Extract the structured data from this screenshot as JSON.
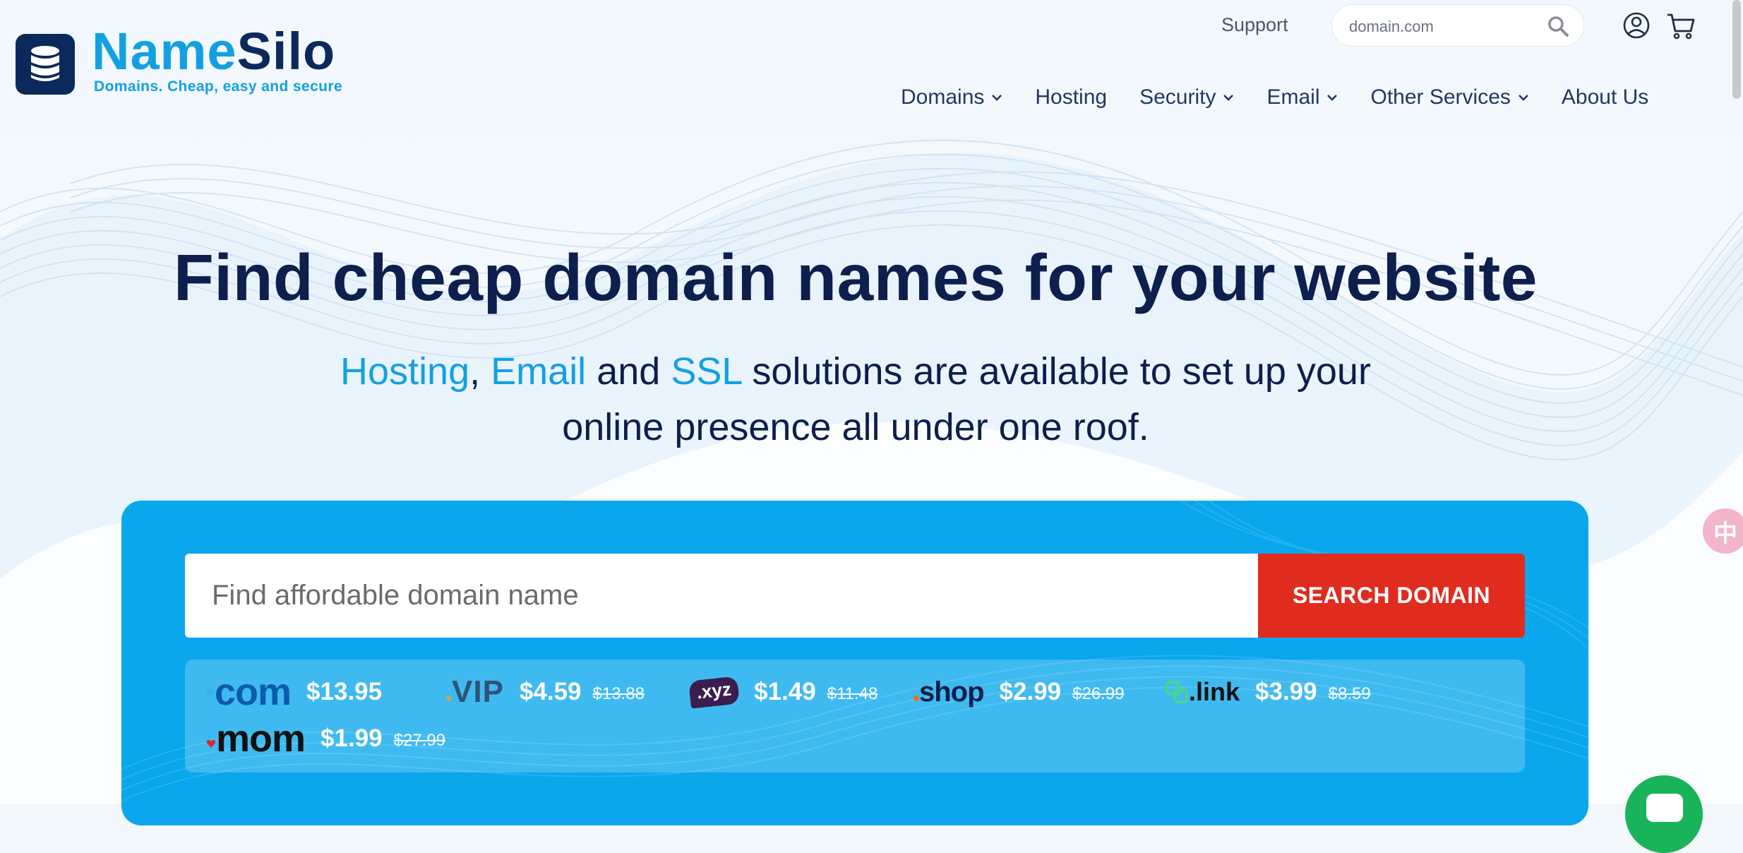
{
  "brand": {
    "name_part1": "Name",
    "name_part2": "Silo",
    "tagline": "Domains. Cheap, easy and secure",
    "logo_icon": "database-icon"
  },
  "topbar": {
    "support_label": "Support",
    "search_placeholder": "domain.com",
    "search_icon": "search-icon",
    "user_icon": "user-circle-icon",
    "cart_icon": "cart-icon"
  },
  "nav": {
    "items": [
      {
        "label": "Domains",
        "has_dropdown": true
      },
      {
        "label": "Hosting",
        "has_dropdown": false
      },
      {
        "label": "Security",
        "has_dropdown": true
      },
      {
        "label": "Email",
        "has_dropdown": true
      },
      {
        "label": "Other Services",
        "has_dropdown": true
      },
      {
        "label": "About Us",
        "has_dropdown": false
      }
    ]
  },
  "hero": {
    "title": "Find cheap domain names for your website",
    "sub_hosting": "Hosting",
    "sub_comma": ",",
    "sub_email": "Email",
    "sub_and": "and",
    "sub_ssl": "SSL",
    "sub_rest1": "solutions are available to set up your",
    "sub_rest2": "online presence all under one roof."
  },
  "search": {
    "placeholder": "Find affordable domain name",
    "button_label": "SEARCH DOMAIN"
  },
  "tlds": [
    {
      "name": ".com",
      "logo_text": "com",
      "price": "$13.95",
      "old_price": ""
    },
    {
      "name": ".VIP",
      "logo_text": "VIP",
      "price": "$4.59",
      "old_price": "$13.88"
    },
    {
      "name": ".xyz",
      "logo_text": ".xyz",
      "price": "$1.49",
      "old_price": "$11.48"
    },
    {
      "name": ".shop",
      "logo_text": "shop",
      "price": "$2.99",
      "old_price": "$26.99"
    },
    {
      "name": ".link",
      "logo_text": ".link",
      "price": "$3.99",
      "old_price": "$8.59"
    },
    {
      "name": ".mom",
      "logo_text": "mom",
      "price": "$1.99",
      "old_price": "$27.99"
    }
  ],
  "colors": {
    "brand_blue": "#13a0e2",
    "navy": "#0d1f4c",
    "panel_blue": "#0aa7ec",
    "search_button_red": "#e02b1f",
    "chat_green": "#19b35a"
  },
  "widgets": {
    "translate_icon": "translate-icon",
    "translate_glyph": "中",
    "chat_icon": "chat-icon"
  }
}
